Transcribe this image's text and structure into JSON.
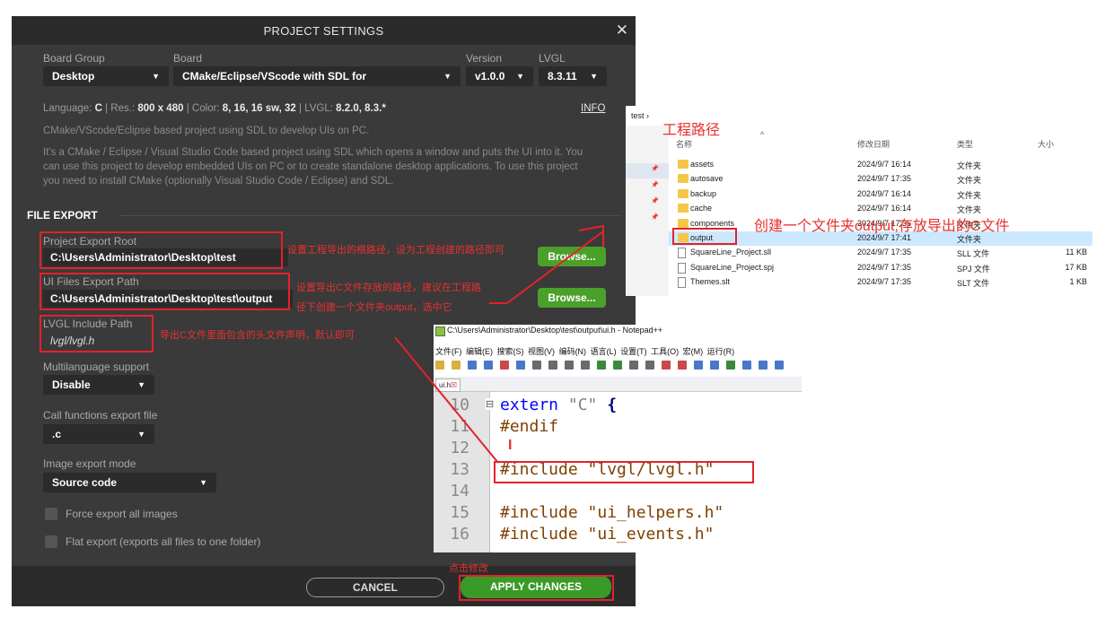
{
  "dialog": {
    "title": "PROJECT SETTINGS",
    "close": "✕",
    "board_group": {
      "label": "Board Group",
      "value": "Desktop"
    },
    "board": {
      "label": "Board",
      "value": "CMake/Eclipse/VScode with SDL for"
    },
    "version": {
      "label": "Version",
      "value": "v1.0.0"
    },
    "lvgl": {
      "label": "LVGL",
      "value": "8.3.11"
    },
    "dropdown_arrow": "▼",
    "info": {
      "language_label": "Language:",
      "language": "C",
      "res_label": "| Res.:",
      "res": "800 x 480",
      "color_label": "| Color:",
      "color": "8, 16, 16 sw, 32",
      "lvgl_label": "| LVGL:",
      "lvgl": "8.2.0, 8.3.*",
      "info_link": "INFO"
    },
    "short_desc": "CMake/VScode/Eclipse based project using SDL to develop UIs on PC.",
    "long_desc": [
      "It's a CMake / Eclipse / Visual Studio Code based project using SDL which opens a window and puts the UI into it. You",
      "can use this project to develop embedded UIs on PC or to create standalone desktop applications. To use this project",
      "you need to install CMake (optionally Visual Studio Code / Eclipse) and SDL."
    ],
    "file_export": {
      "heading": "FILE EXPORT",
      "export_root": {
        "label": "Project Export Root",
        "value": "C:\\Users\\Administrator\\Desktop\\test"
      },
      "ui_files_path": {
        "label": "UI Files Export Path",
        "value": "C:\\Users\\Administrator\\Desktop\\test\\output"
      },
      "browse_label": "Browse...",
      "lvgl_include": {
        "label": "LVGL Include Path",
        "value": "lvgl/lvgl.h"
      },
      "multilanguage": {
        "label": "Multilanguage support",
        "value": "Disable"
      },
      "call_functions": {
        "label": "Call functions export file",
        "value": ".c"
      },
      "image_export": {
        "label": "Image export mode",
        "value": "Source code"
      },
      "force_export": "Force export all images",
      "flat_export": "Flat export (exports all files to one folder)"
    },
    "cancel": "CANCEL",
    "apply": "APPLY CHANGES"
  },
  "annotations": {
    "export_root_note": "设置工程导出的根路径，设为工程创建的路径即可",
    "ui_path_note_1": "设置导出C文件存放的路径，建议在工程路",
    "ui_path_note_2": "径下创建一个文件夹output，选中它",
    "lvgl_note": "导出C文件里面包含的头文件声明，默认即可",
    "project_path_note": "工程路径",
    "output_note": "创建一个文件夹output,存放导出的C文件",
    "apply_note": "点击修改",
    "cursor_mark": "I"
  },
  "explorer": {
    "breadcrumb": "test",
    "breadcrumb_sep": "›",
    "columns": [
      "名称",
      "修改日期",
      "类型",
      "大小"
    ],
    "sort_arrow": "^",
    "pins": [
      "📌",
      "📌",
      "📌",
      "📌"
    ],
    "rows": [
      {
        "name": "assets",
        "date": "2024/9/7 16:14",
        "type": "文件夹",
        "size": "",
        "kind": "folder"
      },
      {
        "name": "autosave",
        "date": "2024/9/7 17:35",
        "type": "文件夹",
        "size": "",
        "kind": "folder"
      },
      {
        "name": "backup",
        "date": "2024/9/7 16:14",
        "type": "文件夹",
        "size": "",
        "kind": "folder"
      },
      {
        "name": "cache",
        "date": "2024/9/7 16:14",
        "type": "文件夹",
        "size": "",
        "kind": "folder"
      },
      {
        "name": "components",
        "date": "2024/9/7 17:35",
        "type": "文件夹",
        "size": "",
        "kind": "folder"
      },
      {
        "name": "output",
        "date": "2024/9/7 17:41",
        "type": "文件夹",
        "size": "",
        "kind": "folder"
      },
      {
        "name": "SquareLine_Project.sll",
        "date": "2024/9/7 17:35",
        "type": "SLL 文件",
        "size": "11 KB",
        "kind": "file"
      },
      {
        "name": "SquareLine_Project.spj",
        "date": "2024/9/7 17:35",
        "type": "SPJ 文件",
        "size": "17 KB",
        "kind": "file"
      },
      {
        "name": "Themes.slt",
        "date": "2024/9/7 17:35",
        "type": "SLT 文件",
        "size": "1 KB",
        "kind": "file"
      }
    ]
  },
  "notepad": {
    "title": "C:\\Users\\Administrator\\Desktop\\test\\output\\ui.h - Notepad++",
    "menu": [
      "文件(F)",
      "编辑(E)",
      "搜索(S)",
      "视图(V)",
      "编码(N)",
      "语言(L)",
      "设置(T)",
      "工具(O)",
      "宏(M)",
      "运行(R)"
    ],
    "tab": "ui.h",
    "tab_close": "☒",
    "lines": [
      {
        "n": "10",
        "parts": [
          {
            "t": "extern ",
            "c": "kw"
          },
          {
            "t": "\"C\" ",
            "c": "str"
          },
          {
            "t": "{",
            "c": "brace"
          }
        ],
        "fold": "⊟"
      },
      {
        "n": "11",
        "parts": [
          {
            "t": "#endif",
            "c": "pp"
          }
        ]
      },
      {
        "n": "12",
        "parts": []
      },
      {
        "n": "13",
        "parts": [
          {
            "t": "#include \"lvgl/lvgl.h\"",
            "c": "pp"
          }
        ]
      },
      {
        "n": "14",
        "parts": []
      },
      {
        "n": "15",
        "parts": [
          {
            "t": "#include \"ui_helpers.h\"",
            "c": "pp"
          }
        ]
      },
      {
        "n": "16",
        "parts": [
          {
            "t": "#include \"ui_events.h\"",
            "c": "pp"
          }
        ]
      }
    ]
  },
  "colors": {
    "dialog_bg": "#3a3a3a",
    "accent_green": "#4ba02a",
    "annotation_red": "#e2222c",
    "selection_blue": "#cce8ff"
  }
}
